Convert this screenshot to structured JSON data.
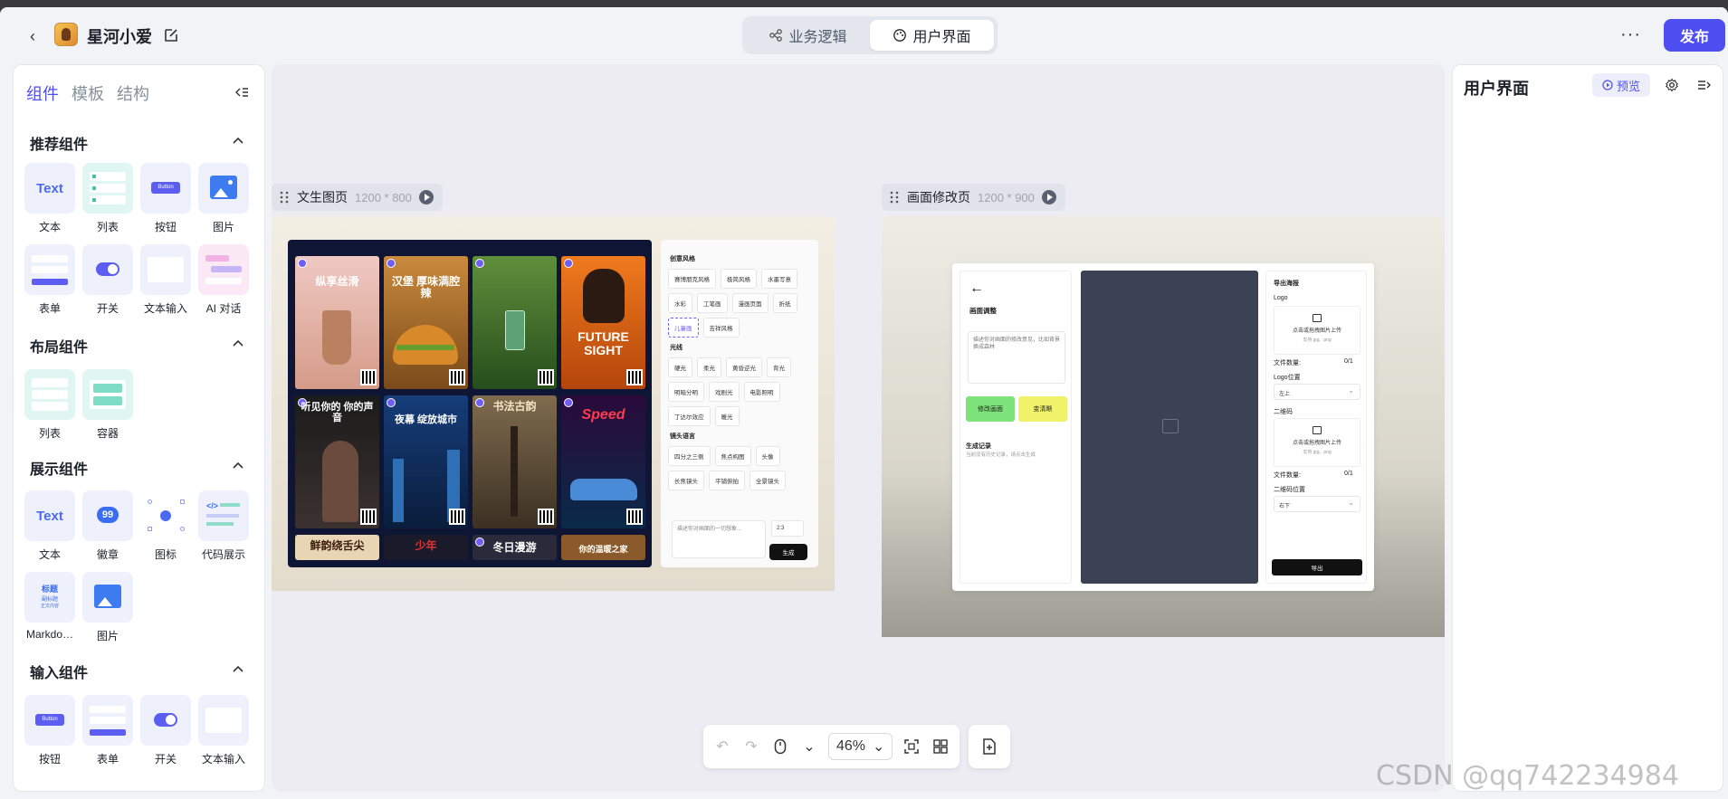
{
  "header": {
    "app_name": "星河小爱",
    "mode_tabs": [
      "业务逻辑",
      "用户界面"
    ],
    "active_mode": "用户界面",
    "publish_label": "发布",
    "more_label": "···"
  },
  "left_panel": {
    "tabs": [
      "组件",
      "模板",
      "结构"
    ],
    "sections": {
      "recommended": {
        "title": "推荐组件",
        "items": [
          "文本",
          "列表",
          "按钮",
          "图片",
          "表单",
          "开关",
          "文本输入",
          "AI 对话"
        ]
      },
      "layout": {
        "title": "布局组件",
        "items": [
          "列表",
          "容器"
        ]
      },
      "display": {
        "title": "展示组件",
        "items": [
          "文本",
          "徽章",
          "图标",
          "代码展示",
          "Markdo…",
          "图片"
        ]
      },
      "input": {
        "title": "输入组件",
        "items": [
          "按钮",
          "表单",
          "开关",
          "文本输入"
        ]
      }
    },
    "tile_texts": {
      "text_tile": "Text",
      "button_tile": "Button",
      "badge_tile": "99",
      "markdown_tile": [
        "标题",
        "副标题",
        "正文内容"
      ]
    }
  },
  "canvas": {
    "pages": [
      {
        "name": "文生图页",
        "size": "1200 * 800",
        "posters": [
          "纵享丝滑",
          "汉堡 厚味满腔辣",
          "",
          "FUTURE SIGHT",
          "听见你的 你的声音",
          "夜幕 绽放城市",
          "书法古韵",
          "Speed",
          "鲜韵绕舌尖",
          "少年",
          "冬日漫游",
          "你的温暖之家"
        ],
        "style_panel": {
          "groups": [
            {
              "title": "创意风格",
              "chips": [
                "赛博朋克风格",
                "极简风格",
                "水墨写意",
                "水彩",
                "工笔画",
                "漫画页面",
                "折纸",
                "儿童画",
                "吉祥风格"
              ],
              "selected": "儿童画"
            },
            {
              "title": "光线",
              "chips": [
                "硬光",
                "柔光",
                "黄昏逆光",
                "背光",
                "明暗分明",
                "戏剧光",
                "电影照明",
                "丁达尔效应",
                "暖光"
              ]
            },
            {
              "title": "镜头语言",
              "chips": [
                "四分之三侧",
                "焦点构图",
                "头像",
                "长焦镜头",
                "平铺俯拍",
                "全景镜头"
              ]
            }
          ],
          "prompt_placeholder": "描述你对画面的一切想象...",
          "ratio": "2:3",
          "generate_label": "生成"
        }
      },
      {
        "name": "画面修改页",
        "size": "1200 * 900",
        "edit_panel": {
          "title": "画面调整",
          "placeholder": "描述你对画面的修改意见，比如背景换成森林",
          "modify_btn": "修改画面",
          "hd_btn": "变清晰",
          "record_title": "生成记录",
          "record_sub": "当前没有历史记录，请点击生成"
        },
        "export_panel": {
          "title": "导出海报",
          "logo_label": "Logo",
          "upload_text": "点击或拖拽图片上传",
          "upload_hint": "支持 jpg、png",
          "file_count_label": "文件数量:",
          "file_count": "0/1",
          "logo_pos_label": "Logo位置",
          "logo_pos": "左上",
          "qr_label": "二维码",
          "qr_pos_label": "二维码位置",
          "qr_pos": "右下",
          "export_label": "导出"
        }
      }
    ]
  },
  "toolbar": {
    "zoom": "46%"
  },
  "right_panel": {
    "title": "用户界面",
    "preview_label": "预览"
  },
  "watermark": "CSDN @qq742234984",
  "colors": {
    "accent": "#4e4ff0",
    "panel_bg": "#ffffff",
    "canvas_bg": "#ececf2"
  }
}
